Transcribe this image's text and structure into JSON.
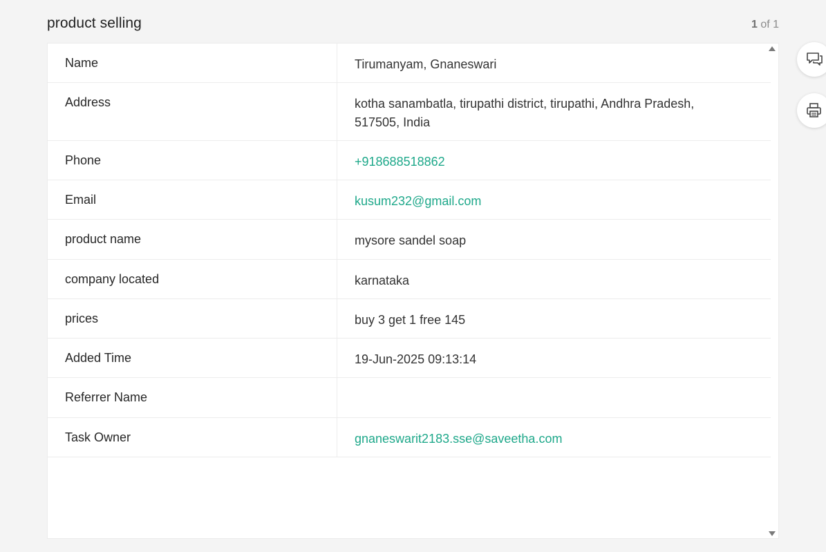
{
  "form": {
    "title": "product selling",
    "pager": {
      "current": "1",
      "of_label": "of 1"
    }
  },
  "rows": [
    {
      "label": "Name",
      "value": "Tirumanyam, Gnaneswari",
      "type": "text"
    },
    {
      "label": "Address",
      "value": "kotha sanambatla, tirupathi district, tirupathi, Andhra Pradesh, 517505, India",
      "type": "text"
    },
    {
      "label": "Phone",
      "value": "+918688518862",
      "type": "link"
    },
    {
      "label": "Email",
      "value": "kusum232@gmail.com",
      "type": "link"
    },
    {
      "label": "product name",
      "value": "mysore sandel soap",
      "type": "text"
    },
    {
      "label": "company located",
      "value": "karnataka",
      "type": "text"
    },
    {
      "label": "prices",
      "value": "buy 3 get 1 free 145",
      "type": "text"
    },
    {
      "label": "Added Time",
      "value": "19-Jun-2025 09:13:14",
      "type": "text"
    },
    {
      "label": "Referrer Name",
      "value": "",
      "type": "text"
    },
    {
      "label": "Task Owner",
      "value": "gnaneswarit2183.sse@saveetha.com",
      "type": "link"
    }
  ],
  "sidebar_actions": [
    {
      "icon": "comment-icon"
    },
    {
      "icon": "print-icon"
    }
  ],
  "colors": {
    "link": "#1ea88a",
    "background": "#f4f4f4",
    "card": "#ffffff",
    "border": "#ececec"
  }
}
